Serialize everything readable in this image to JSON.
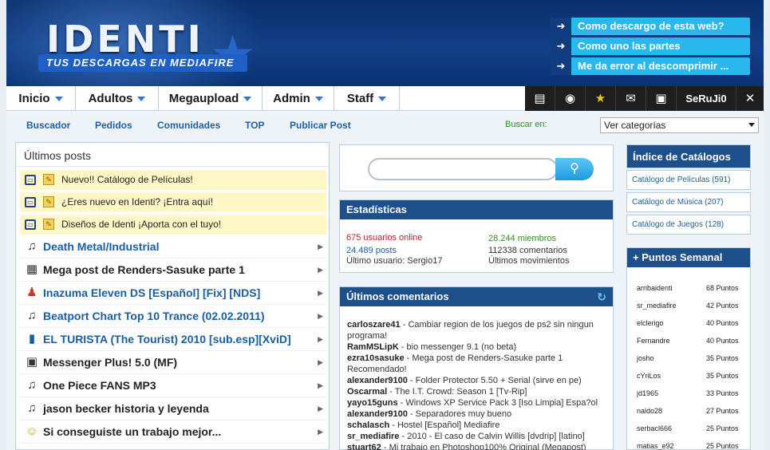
{
  "header": {
    "logo": "IDENTI",
    "slogan": "TUS DESCARGAS EN MEDIAFIRE",
    "help_links": [
      "Como descargo de esta web?",
      "Como uno las partes descargadas?",
      "Me da error al descomprimir ..."
    ]
  },
  "nav": {
    "items": [
      "Inicio",
      "Adultos",
      "Megaupload",
      "Admin",
      "Staff"
    ],
    "user": "SeRuJi0",
    "icons": [
      "clipboard-icon",
      "eye-icon",
      "star-icon",
      "mail-icon",
      "monitor-icon",
      "close-icon"
    ]
  },
  "subnav": {
    "links": [
      "Buscador",
      "Pedidos",
      "Comunidades",
      "TOP",
      "Publicar Post"
    ],
    "search_label": "Buscar en:",
    "select_value": "Ver categorías"
  },
  "left": {
    "title": "Últimos posts",
    "sticky": [
      "Nuevo!! Catálogo de Películas!",
      "¿Eres nuevo en Identi? ¡Entra aquí!",
      "Diseños de Identi ¡Aporta con el tuyo!"
    ],
    "posts": [
      {
        "title": "Death Metal/Industrial",
        "icon": "music-note-icon",
        "color": "blue"
      },
      {
        "title": "Mega post de Renders-Sasuke parte 1",
        "icon": "image-icon",
        "color": "dark"
      },
      {
        "title": "Inazuma Eleven DS [Español] [Fix] [NDS]",
        "icon": "game-icon",
        "color": "blue"
      },
      {
        "title": "Beatport Chart Top 10 Trance (02.02.2011)",
        "icon": "music-note-icon",
        "color": "blue"
      },
      {
        "title": "EL TURISTA (The Tourist) 2010 [sub.esp][XviD]",
        "icon": "film-icon",
        "color": "blue"
      },
      {
        "title": "Messenger Plus! 5.0 (MF)",
        "icon": "floppy-icon",
        "color": "dark"
      },
      {
        "title": "One Piece FANS MP3",
        "icon": "music-note-icon",
        "color": "dark"
      },
      {
        "title": "jason becker historia y leyenda",
        "icon": "music-note-icon",
        "color": "dark"
      },
      {
        "title": "Si conseguiste un trabajo mejor...",
        "icon": "smiley-icon",
        "color": "dark"
      }
    ]
  },
  "stats": {
    "title": "Estadísticas",
    "online": "675 usuarios online",
    "members": "28.244 miembros",
    "posts": "24.489 posts",
    "comments": "112338 comentarios",
    "last_user": "Último usuario: Sergio17",
    "last_moves": "Últimos movimientos"
  },
  "comments": {
    "title": "Últimos comentarios",
    "items": [
      {
        "user": "carloszare41",
        "text": " - Cambiar region de los juegos de ps2 sin ningun programa!"
      },
      {
        "user": "RamMSLipK",
        "text": " - bio messenger 9.1 (no beta)"
      },
      {
        "user": "ezra10sasuke",
        "text": " - Mega post de Renders-Sasuke parte 1 Recomendado!"
      },
      {
        "user": "alexander9100",
        "text": " - Folder Protector 5.50 + Serial (sirve en pe)"
      },
      {
        "user": "Oscarmal",
        "text": " - The I.T. Crowd: Season 1 [Tv-Rip]"
      },
      {
        "user": "yayo15guns",
        "text": " - Windows XP Service Pack 3 [Iso Limpia] Espa?ol"
      },
      {
        "user": "alexander9100",
        "text": " - Separadores muy bueno"
      },
      {
        "user": "schalasch",
        "text": " - Hostel [Español] Mediafire"
      },
      {
        "user": "sr_mediafire",
        "text": " - 2010 - El caso de Calvin Willis [dvdrip] [latino]"
      },
      {
        "user": "stuart62",
        "text": " - Mi trabajo en Photoshop100% Original (Megapost)"
      }
    ]
  },
  "catalogs": {
    "title": "Índice de Catálogos",
    "items": [
      "Catálogo de Películas (591)",
      "Catálogo de Música (207)",
      "Catálogo de Juegos (128)"
    ]
  },
  "points": {
    "title": "+ Puntos Semanal",
    "items": [
      {
        "user": "arribaidenti",
        "pts": "68 Puntos"
      },
      {
        "user": "sr_mediafire",
        "pts": "42 Puntos"
      },
      {
        "user": "elclerigo",
        "pts": "40 Puntos"
      },
      {
        "user": "Fernandre",
        "pts": "40 Puntos"
      },
      {
        "user": "josho",
        "pts": "35 Puntos"
      },
      {
        "user": "cYriLos",
        "pts": "35 Puntos"
      },
      {
        "user": "jd1965",
        "pts": "33 Puntos"
      },
      {
        "user": "naldo28",
        "pts": "27 Puntos"
      },
      {
        "user": "serbacl666",
        "pts": "25 Puntos"
      },
      {
        "user": "matias_e92",
        "pts": "25 Puntos"
      }
    ]
  },
  "colors": {
    "header": "#0a2f6b",
    "accent": "#2ab7ee",
    "panel_head": "#1d4f8a",
    "link": "#1a5ea0"
  }
}
